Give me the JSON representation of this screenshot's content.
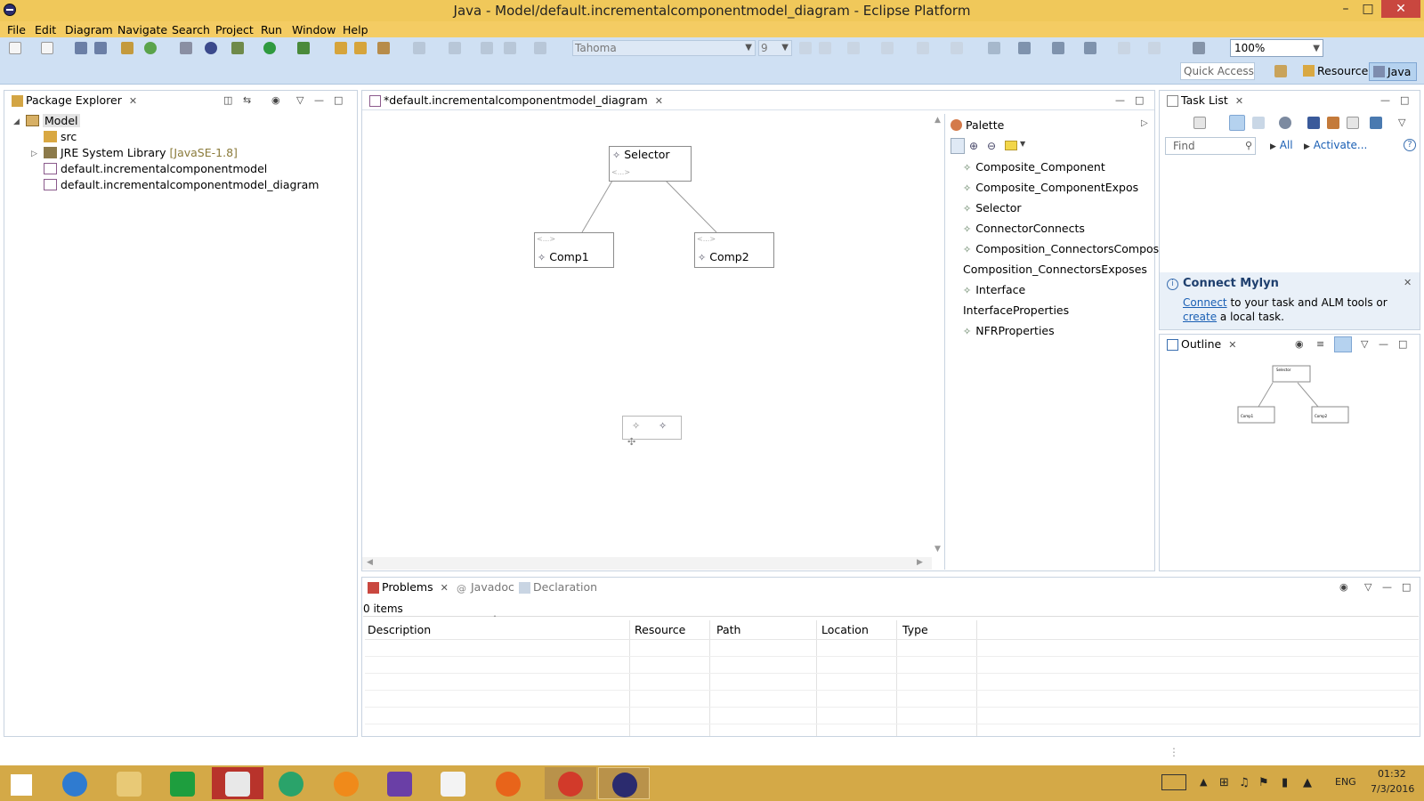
{
  "window": {
    "title": "Java - Model/default.incrementalcomponentmodel_diagram - Eclipse Platform",
    "minimize": "–",
    "maximize": "□",
    "close": "✕"
  },
  "menu": [
    "File",
    "Edit",
    "Diagram",
    "Navigate",
    "Search",
    "Project",
    "Run",
    "Window",
    "Help"
  ],
  "toolbar": {
    "font_name": "Tahoma",
    "font_size": "9",
    "zoom": "100%",
    "quick_access_placeholder": "Quick Access",
    "perspectives": [
      "Resource",
      "Java"
    ]
  },
  "package_explorer": {
    "tab_label": "Package Explorer",
    "tree": {
      "project": "Model",
      "src": "src",
      "jre": "JRE System Library",
      "jre_version": "[JavaSE-1.8]",
      "file1": "default.incrementalcomponentmodel",
      "file2": "default.incrementalcomponentmodel_diagram"
    }
  },
  "editor": {
    "tab_label": "*default.incrementalcomponentmodel_diagram",
    "nodes": {
      "selector": "Selector",
      "comp1": "Comp1",
      "comp2": "Comp2",
      "placeholder": "<...>"
    }
  },
  "palette": {
    "title": "Palette",
    "items": [
      "Composite_Component",
      "Composite_ComponentExpos",
      "Selector",
      "ConnectorConnects",
      "Composition_ConnectorsComposes",
      "Composition_ConnectorsExposes",
      "Interface",
      "InterfaceProperties",
      "NFRProperties"
    ]
  },
  "task_list": {
    "tab_label": "Task List",
    "find_placeholder": "Find",
    "all_label": "All",
    "activate_label": "Activate...",
    "mylyn": {
      "title": "Connect Mylyn",
      "link1": "Connect",
      "text1": "to your task and ALM tools or",
      "link2": "create",
      "text2": "a local task."
    }
  },
  "outline": {
    "tab_label": "Outline",
    "mini_selector": "Selector",
    "mini_comp1": "Comp1",
    "mini_comp2": "Comp2"
  },
  "bottom": {
    "tabs": [
      "Problems",
      "Javadoc",
      "Declaration"
    ],
    "item_count": "0 items",
    "columns": [
      "Description",
      "Resource",
      "Path",
      "Location",
      "Type"
    ]
  },
  "taskbar": {
    "lang": "ENG",
    "time": "01:32",
    "date": "7/3/2016"
  },
  "colors": {
    "titlebar": "#f0c85a",
    "toolbar": "#cfe0f3",
    "taskbar": "#d4a947",
    "link": "#1a5fb4"
  }
}
